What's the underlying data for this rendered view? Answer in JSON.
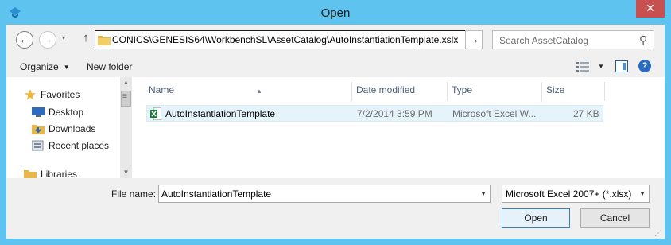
{
  "window": {
    "title": "Open",
    "close_glyph": "✕"
  },
  "navigation": {
    "back_glyph": "←",
    "forward_glyph": "→",
    "history_glyph": "▾",
    "up_glyph": "↑"
  },
  "address_bar": {
    "path": "CONICS\\GENESIS64\\WorkbenchSL\\AssetCatalog\\AutoInstantiationTemplate.xslx",
    "go_glyph": "→"
  },
  "search": {
    "placeholder": "Search AssetCatalog",
    "icon_glyph": "⚲"
  },
  "toolbar": {
    "organize_label": "Organize",
    "new_folder_label": "New folder",
    "caret_glyph": "▼",
    "help_glyph": "?"
  },
  "sidebar": {
    "items": [
      {
        "label": "Favorites",
        "icon": "star-icon"
      },
      {
        "label": "Desktop",
        "icon": "desktop-icon"
      },
      {
        "label": "Downloads",
        "icon": "downloads-folder-icon"
      },
      {
        "label": "Recent places",
        "icon": "recent-places-icon"
      },
      {
        "label": "Libraries",
        "icon": "libraries-icon"
      }
    ]
  },
  "file_list": {
    "columns": [
      "Name",
      "Date modified",
      "Type",
      "Size"
    ],
    "sort_glyph": "▲",
    "rows": [
      {
        "name": "AutoInstantiationTemplate",
        "date_modified": "7/2/2014 3:59 PM",
        "type": "Microsoft Excel W...",
        "size": "27 KB"
      }
    ]
  },
  "bottom": {
    "file_name_label": "File name:",
    "file_name_value": "AutoInstantiationTemplate",
    "filter_value": "Microsoft Excel 2007+ (*.xlsx)",
    "open_label": "Open",
    "cancel_label": "Cancel",
    "dropdown_glyph": "▼"
  },
  "colors": {
    "title_bar": "#5ec4ef",
    "close_button": "#c75050",
    "selection": "#e5f3fb",
    "column_header_text": "#4c607a"
  }
}
